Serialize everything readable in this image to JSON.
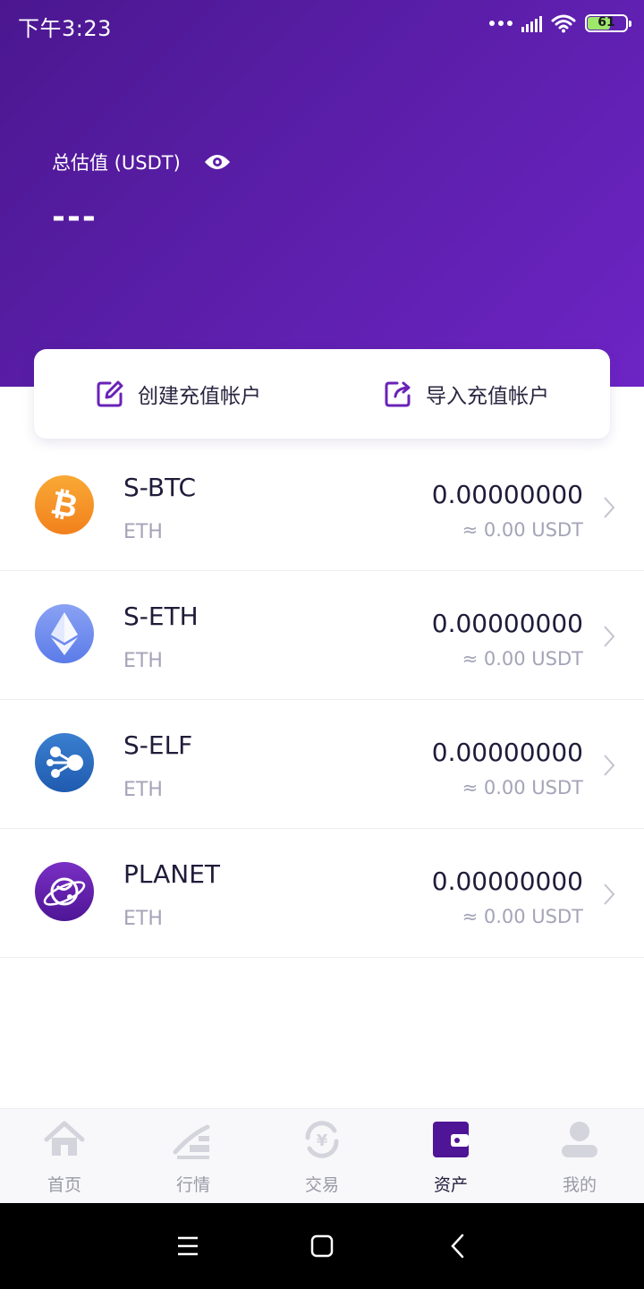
{
  "status_bar": {
    "time": "下午3:23",
    "battery": "61"
  },
  "header": {
    "total_label": "总估值 (USDT)",
    "total_value": "---"
  },
  "actions": [
    {
      "label": "创建充值帐户",
      "icon": "edit-icon"
    },
    {
      "label": "导入充值帐户",
      "icon": "import-icon"
    }
  ],
  "assets": [
    {
      "name": "S-BTC",
      "chain": "ETH",
      "amount": "0.00000000",
      "usdt": "≈ 0.00 USDT",
      "icon": "bitcoin-icon"
    },
    {
      "name": "S-ETH",
      "chain": "ETH",
      "amount": "0.00000000",
      "usdt": "≈ 0.00 USDT",
      "icon": "ethereum-icon"
    },
    {
      "name": "S-ELF",
      "chain": "ETH",
      "amount": "0.00000000",
      "usdt": "≈ 0.00 USDT",
      "icon": "aelf-icon"
    },
    {
      "name": "PLANET",
      "chain": "ETH",
      "amount": "0.00000000",
      "usdt": "≈ 0.00 USDT",
      "icon": "planet-icon"
    }
  ],
  "tabs": [
    {
      "label": "首页",
      "icon": "home-icon",
      "active": false
    },
    {
      "label": "行情",
      "icon": "market-icon",
      "active": false
    },
    {
      "label": "交易",
      "icon": "exchange-icon",
      "active": false
    },
    {
      "label": "资产",
      "icon": "wallet-icon",
      "active": true
    },
    {
      "label": "我的",
      "icon": "profile-icon",
      "active": false
    }
  ],
  "colors": {
    "header_start": "#4b1790",
    "header_end": "#6d24c4",
    "accent": "#6a22b8",
    "text_primary": "#1f1c3a",
    "text_secondary": "#a4a4b8"
  }
}
